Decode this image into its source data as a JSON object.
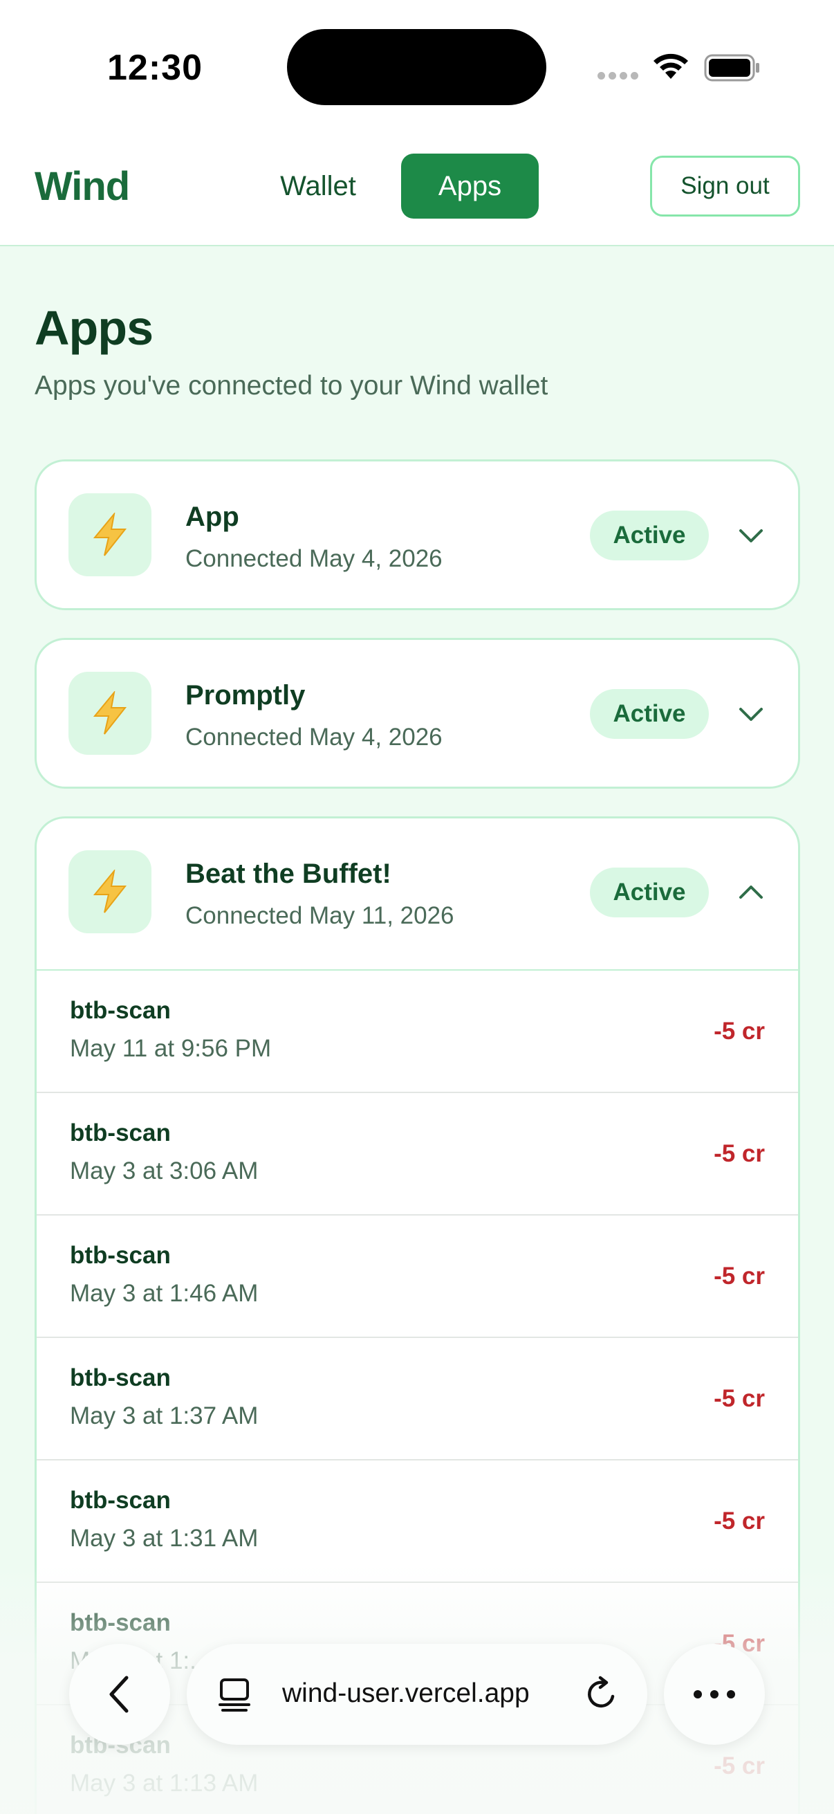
{
  "status_bar": {
    "time": "12:30"
  },
  "nav": {
    "brand": "Wind",
    "tabs": [
      {
        "label": "Wallet",
        "active": false
      },
      {
        "label": "Apps",
        "active": true
      }
    ],
    "sign_out": "Sign out"
  },
  "page": {
    "title": "Apps",
    "subtitle": "Apps you've connected to your Wind wallet"
  },
  "apps": [
    {
      "name": "App",
      "connected": "Connected May 4, 2026",
      "status": "Active",
      "expanded": false,
      "icon": "lightning-icon"
    },
    {
      "name": "Promptly",
      "connected": "Connected May 4, 2026",
      "status": "Active",
      "expanded": false,
      "icon": "lightning-icon"
    },
    {
      "name": "Beat the Buffet!",
      "connected": "Connected May 11, 2026",
      "status": "Active",
      "expanded": true,
      "icon": "lightning-icon",
      "usage": [
        {
          "name": "btb-scan",
          "time": "May 11 at 9:56 PM",
          "amount": "-5 cr"
        },
        {
          "name": "btb-scan",
          "time": "May 3 at 3:06 AM",
          "amount": "-5 cr"
        },
        {
          "name": "btb-scan",
          "time": "May 3 at 1:46 AM",
          "amount": "-5 cr"
        },
        {
          "name": "btb-scan",
          "time": "May 3 at 1:37 AM",
          "amount": "-5 cr"
        },
        {
          "name": "btb-scan",
          "time": "May 3 at 1:31 AM",
          "amount": "-5 cr"
        },
        {
          "name": "btb-scan",
          "time": "May 3 at 1:...",
          "amount": "-5 cr"
        },
        {
          "name": "btb-scan",
          "time": "May 3 at 1:13 AM",
          "amount": "-5 cr"
        }
      ]
    }
  ],
  "browser": {
    "url": "wind-user.vercel.app"
  },
  "colors": {
    "brand_green": "#1a6b3b",
    "active_tab": "#1d8a48",
    "badge_bg": "#d9f8e4",
    "debit_red": "#c0262b",
    "background": "#eefbf2"
  }
}
